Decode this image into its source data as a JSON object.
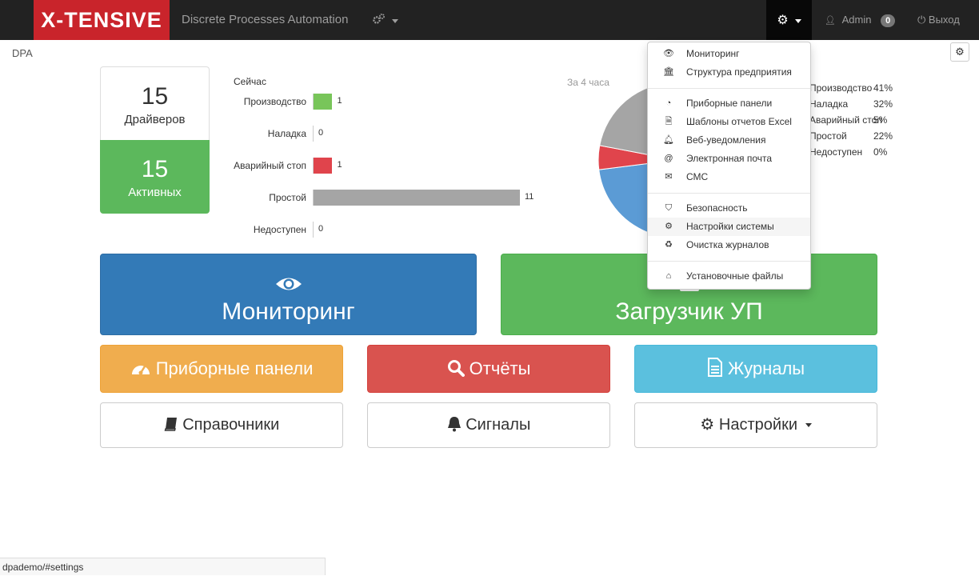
{
  "navbar": {
    "brand": "X-TENSIVE",
    "app_title": "Discrete Processes Automation",
    "cogs_icon": "cogs-icon",
    "settings_icon": "gear-icon",
    "user": "Admin",
    "user_badge": "0",
    "logout": "Выход"
  },
  "breadcrumb": "DPA",
  "stats": {
    "drivers_count": "15",
    "drivers_label": "Драйверов",
    "active_count": "15",
    "active_label": "Активных"
  },
  "now_chart": {
    "title": "Сейчас"
  },
  "pie_chart": {
    "title": "За 4 часа",
    "legend": [
      {
        "label": "Производство",
        "pct": "41%"
      },
      {
        "label": "Наладка",
        "pct": "32%"
      },
      {
        "label": "Аварийный стоп",
        "pct": "5%"
      },
      {
        "label": "Простой",
        "pct": "22%"
      },
      {
        "label": "Недоступен",
        "pct": "0%"
      }
    ]
  },
  "chart_data": [
    {
      "type": "bar",
      "title": "Сейчас",
      "categories": [
        "Производство",
        "Наладка",
        "Аварийный стоп",
        "Простой",
        "Недоступен"
      ],
      "values": [
        1,
        0,
        1,
        11,
        0
      ],
      "colors": [
        "#78c55a",
        "#5b9bd5",
        "#e0444c",
        "#a5a5a5",
        "#cccccc"
      ]
    },
    {
      "type": "pie",
      "title": "За 4 часа",
      "categories": [
        "Производство",
        "Наладка",
        "Аварийный стоп",
        "Простой",
        "Недоступен"
      ],
      "values": [
        41,
        32,
        5,
        22,
        0
      ],
      "colors": [
        "#78c55a",
        "#5b9bd5",
        "#e0444c",
        "#a5a5a5",
        "#cccccc"
      ]
    }
  ],
  "buttons": {
    "monitoring": "Мониторинг",
    "loader": "Загрузчик УП",
    "dashboards": "Приборные панели",
    "reports": "Отчёты",
    "journals": "Журналы",
    "references": "Справочники",
    "signals": "Сигналы",
    "settings": "Настройки"
  },
  "dropdown": {
    "items": [
      {
        "label": "Мониторинг",
        "icon": "eye-icon"
      },
      {
        "label": "Структура предприятия",
        "icon": "bank-icon"
      },
      {
        "label": "Приборные панели",
        "icon": "dashboard-icon"
      },
      {
        "label": "Шаблоны отчетов Excel",
        "icon": "excel-file-icon"
      },
      {
        "label": "Веб-уведомления",
        "icon": "bell-icon"
      },
      {
        "label": "Электронная почта",
        "icon": "at-icon"
      },
      {
        "label": "СМС",
        "icon": "envelope-icon"
      },
      {
        "label": "Безопасность",
        "icon": "shield-icon"
      },
      {
        "label": "Настройки системы",
        "icon": "cogs-icon"
      },
      {
        "label": "Очистка журналов",
        "icon": "recycle-icon"
      },
      {
        "label": "Установочные файлы",
        "icon": "hdd-icon"
      }
    ]
  },
  "status_bar": "dpademo/#settings"
}
